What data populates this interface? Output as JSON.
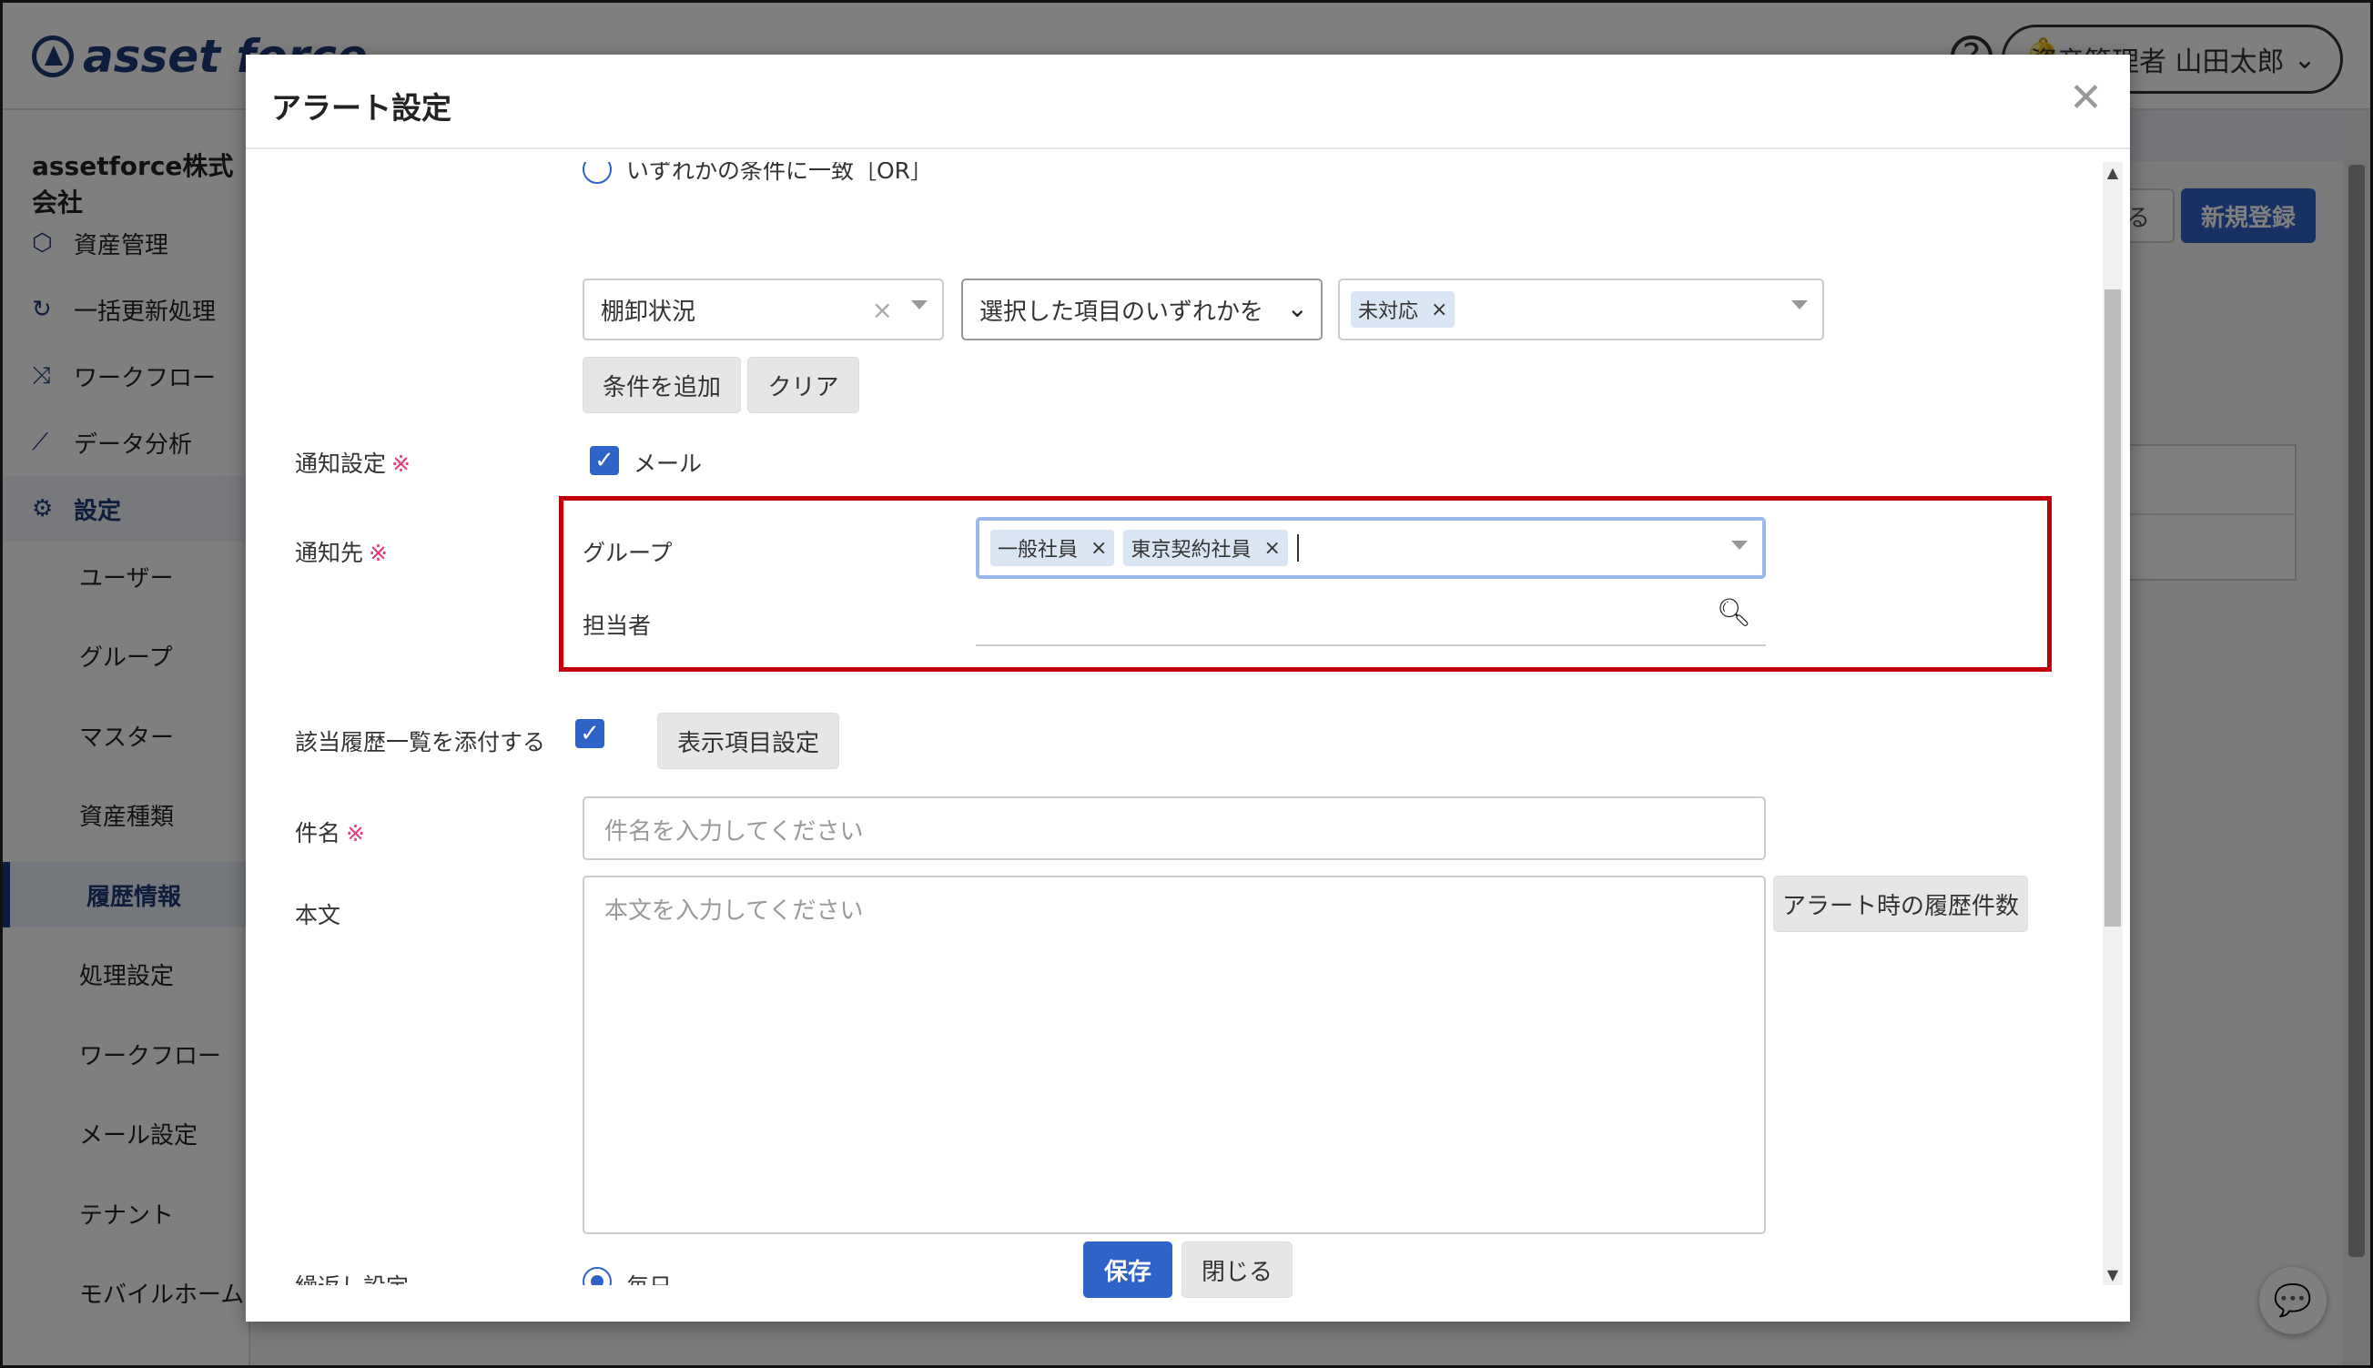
{
  "app": {
    "logo_text": "asset force",
    "user_menu_label": "資産管理者 山田太郎",
    "company_name": "assetforce株式会社",
    "sidebar_items": [
      {
        "label": "資産管理",
        "icon": "cube-icon"
      },
      {
        "label": "一括更新処理",
        "icon": "refresh-icon"
      },
      {
        "label": "ワークフロー",
        "icon": "workflow-icon"
      },
      {
        "label": "データ分析",
        "icon": "chart-icon"
      },
      {
        "label": "設定",
        "icon": "gear-icon"
      }
    ],
    "sidebar_sub_items": [
      {
        "label": "ユーザー"
      },
      {
        "label": "グループ"
      },
      {
        "label": "マスター"
      },
      {
        "label": "資産種類"
      },
      {
        "label": "履歴情報"
      },
      {
        "label": "処理設定"
      },
      {
        "label": "ワークフロー"
      },
      {
        "label": "メール設定"
      },
      {
        "label": "テナント"
      },
      {
        "label": "モバイルホーム"
      }
    ],
    "bg_new_button": "新規登録",
    "bg_ghost_button": "る"
  },
  "modal": {
    "title": "アラート設定",
    "or_condition_label": "いずれかの条件に一致［OR］",
    "condition": {
      "field_value": "棚卸状況",
      "operator_value": "選択した項目のいずれかを",
      "values": [
        "未対応"
      ]
    },
    "add_condition_button": "条件を追加",
    "clear_button": "クリア",
    "notify_setting": {
      "label": "通知設定",
      "required_mark": "※",
      "mail_label": "メール"
    },
    "notify_target": {
      "label": "通知先",
      "required_mark": "※",
      "group_label": "グループ",
      "groups": [
        "一般社員",
        "東京契約社員"
      ],
      "assignee_label": "担当者"
    },
    "attach_history": {
      "label": "該当履歴一覧を添付する",
      "display_settings_button": "表示項目設定"
    },
    "subject": {
      "label": "件名",
      "required_mark": "※",
      "placeholder": "件名を入力してください"
    },
    "body": {
      "label": "本文",
      "placeholder": "本文を入力してください",
      "history_count_button": "アラート時の履歴件数"
    },
    "repeat": {
      "label": "繰返し設定",
      "option_label": "毎日"
    },
    "save_button": "保存",
    "close_button": "閉じる"
  }
}
